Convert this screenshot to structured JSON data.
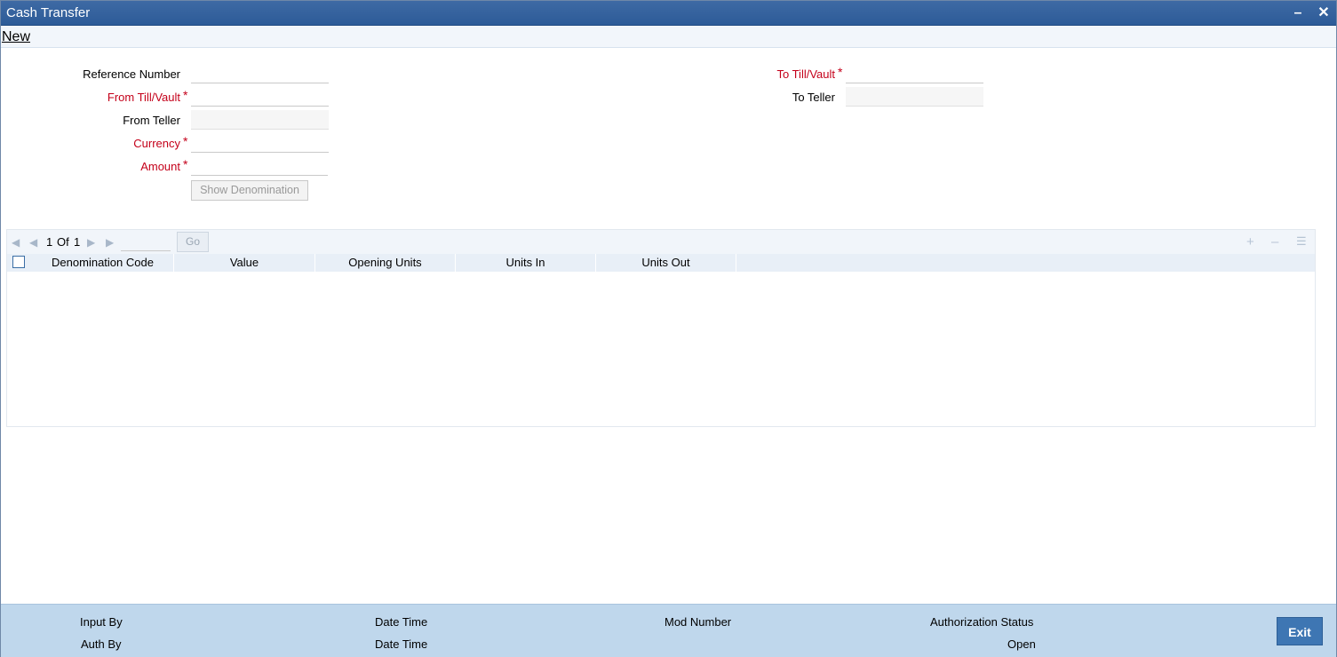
{
  "window": {
    "title": "Cash Transfer"
  },
  "toolbar": {
    "new_label": "New"
  },
  "form": {
    "reference_number": {
      "label": "Reference Number",
      "value": ""
    },
    "from_till_vault": {
      "label": "From Till/Vault",
      "value": "",
      "required": "*"
    },
    "from_teller": {
      "label": "From Teller",
      "value": ""
    },
    "currency": {
      "label": "Currency",
      "value": "",
      "required": "*"
    },
    "amount": {
      "label": "Amount",
      "value": "",
      "required": "*"
    },
    "to_till_vault": {
      "label": "To Till/Vault",
      "value": "",
      "required": "*"
    },
    "to_teller": {
      "label": "To Teller",
      "value": ""
    },
    "show_denomination_label": "Show Denomination"
  },
  "grid": {
    "page_current": "1",
    "page_of": "Of",
    "page_total": "1",
    "go_label": "Go",
    "columns": [
      "Denomination Code",
      "Value",
      "Opening Units",
      "Units In",
      "Units Out"
    ],
    "rows": []
  },
  "footer": {
    "input_by": "Input By",
    "date_time_1": "Date Time",
    "mod_number": "Mod Number",
    "authorization_status": "Authorization Status",
    "auth_by": "Auth By",
    "date_time_2": "Date Time",
    "status_value": "Open",
    "exit_label": "Exit"
  }
}
